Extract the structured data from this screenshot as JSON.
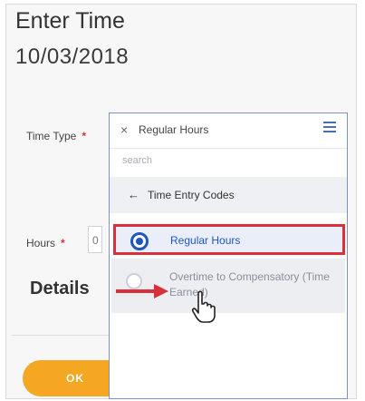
{
  "page": {
    "title": "Enter Time",
    "date": "10/03/2018"
  },
  "form": {
    "time_type_label": "Time Type",
    "required_mark": "*",
    "hours_label": "Hours",
    "hours_value": "0",
    "details_heading": "Details",
    "ok_label": "OK"
  },
  "dropdown": {
    "selected_chip": "Regular Hours",
    "clear_glyph": "×",
    "search_placeholder": "search",
    "back_glyph": "←",
    "category": "Time Entry Codes",
    "options": [
      {
        "label": "Regular Hours",
        "selected": true
      },
      {
        "label": "Overtime to Compensatory (Time Earned)",
        "selected": false
      }
    ]
  },
  "icons": {
    "menu": "list-menu-icon",
    "back": "back-arrow-icon",
    "cursor": "hand-pointer-icon",
    "annotation": "red-arrow-icon"
  },
  "colors": {
    "accent_blue": "#1f56c2",
    "highlight_red": "#d9313b",
    "ok_orange": "#f5a623"
  }
}
